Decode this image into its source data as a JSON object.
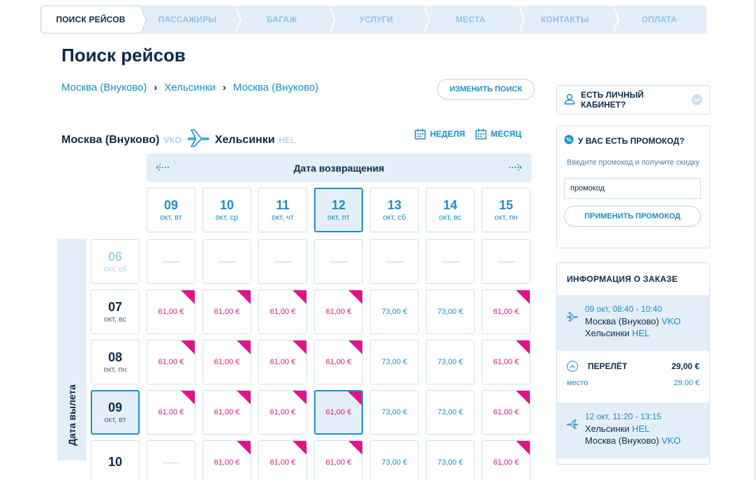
{
  "steps": [
    "ПОИСК РЕЙСОВ",
    "ПАССАЖИРЫ",
    "БАГАЖ",
    "УСЛУГИ",
    "МЕСТА",
    "КОНТАКТЫ",
    "ОПЛАТА"
  ],
  "page_title": "Поиск рейсов",
  "breadcrumb": [
    "Москва (Внуково)",
    "Хельсинки",
    "Москва (Внуково)"
  ],
  "breadcrumb_sep": "›",
  "change_search": "ИЗМЕНИТЬ ПОИСК",
  "route": {
    "from": "Москва (Внуково)",
    "from_code": "VKO",
    "to": "Хельсинки",
    "to_code": "HEL"
  },
  "view": {
    "week": "НЕДЕЛЯ",
    "month": "МЕСЯЦ"
  },
  "return_label": "Дата возвращения",
  "departure_label": "Дата вылета",
  "return_dates": [
    {
      "d": "09",
      "w": "окт, вт"
    },
    {
      "d": "10",
      "w": "окт, ср"
    },
    {
      "d": "11",
      "w": "окт, чт"
    },
    {
      "d": "12",
      "w": "окт, пт"
    },
    {
      "d": "13",
      "w": "окт, сб"
    },
    {
      "d": "14",
      "w": "окт, вс"
    },
    {
      "d": "15",
      "w": "окт, пн"
    }
  ],
  "selected_return_index": 3,
  "departure_dates": [
    {
      "d": "06",
      "w": "окт, сб"
    },
    {
      "d": "07",
      "w": "окт, вс"
    },
    {
      "d": "08",
      "w": "окт, пн"
    },
    {
      "d": "09",
      "w": "окт, вт"
    },
    {
      "d": "10",
      "w": ""
    }
  ],
  "selected_departure_index": 3,
  "price_grid": [
    [
      "",
      "",
      "",
      "",
      "",
      "",
      ""
    ],
    [
      "61,00 €",
      "61,00 €",
      "61,00 €",
      "61,00 €",
      "73,00 €",
      "73,00 €",
      "61,00 €"
    ],
    [
      "61,00 €",
      "61,00 €",
      "61,00 €",
      "61,00 €",
      "73,00 €",
      "73,00 €",
      "61,00 €"
    ],
    [
      "61,00 €",
      "61,00 €",
      "61,00 €",
      "61,00 €",
      "73,00 €",
      "73,00 €",
      "61,00 €"
    ],
    [
      "",
      "61,00 €",
      "61,00 €",
      "61,00 €",
      "73,00 €",
      "73,00 €",
      "61,00 €"
    ]
  ],
  "cabinet": "ЕСТЬ ЛИЧНЫЙ КАБИНЕТ?",
  "promo": {
    "head": "У ВАС ЕСТЬ ПРОМОКОД?",
    "hint": "Введите промокод и получите скидку",
    "input_value": "промокод",
    "apply": "ПРИМЕНИТЬ ПРОМОКОД"
  },
  "order": {
    "title": "ИНФОРМАЦИЯ О ЗАКАЗЕ",
    "outbound": {
      "time": "09 окт, 08:40 - 10:40",
      "from": "Москва (Внуково)",
      "from_code": "VKO",
      "to": "Хельсинки",
      "to_code": "HEL"
    },
    "fare_label": "ПЕРЕЛЁТ",
    "fare_amount": "29,00 €",
    "seat_label": "место",
    "seat_amount": "29,00 €",
    "inbound": {
      "time": "12 окт, 11:20 - 13:15",
      "from": "Хельсинки",
      "from_code": "HEL",
      "to": "Москва (Внуково)",
      "to_code": "VKO"
    }
  },
  "colors": {
    "accent": "#1a8fc6",
    "navy": "#0d2a4a",
    "pink": "#e0148a",
    "light": "#e4eef8"
  }
}
